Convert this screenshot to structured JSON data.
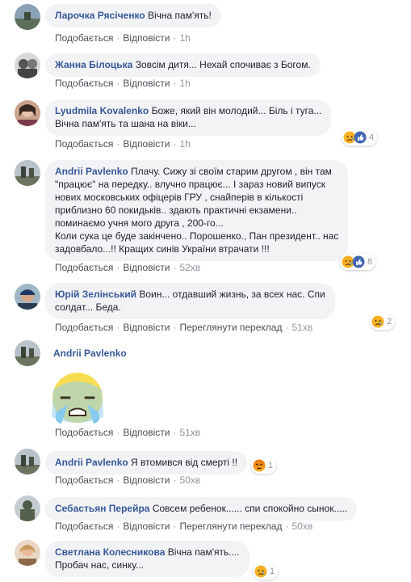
{
  "actions": {
    "like": "Подобається",
    "reply": "Відповісти",
    "translate": "Переглянути переклад"
  },
  "comments": [
    {
      "name": "Ларочка Рясіченко",
      "text": "Вічна пам'ять!",
      "time": "1h"
    },
    {
      "name": "Жанна Білоцька",
      "text": "Зовсім дитя... Нехай спочиває з Богом.",
      "time": "1h"
    },
    {
      "name": "Lyudmila Kovalenko",
      "text": "Боже, який він молодий... Біль і туга...\nВічна пам'ять та шана на віки...",
      "time": "1h",
      "reaction_count": "4"
    },
    {
      "name": "Andrii Pavlenko",
      "text": "Плачу. Сижу зі своїм старим другом , він там\n\"працює\" на передку.. влучно працює... І зараз новий випуск\nнових московських офіцерів ГРУ , снайперів в кількості\nприблизно 60 покидьків.. здають практичні екзамени..\nпоминаємо учня мого друга , 200-го...\nКоли сука це буде закінчено.. Порошенко., Пан президент.. нас\nзадовбало...!! Кращих синів України втрачати !!!",
      "time": "52хв",
      "reaction_count": "8"
    },
    {
      "name": "Юрій Зелінський",
      "text": "Воин... отдавший жизнь, за всех нас. Спи\nсолдат... Беда.",
      "time": "51хв",
      "reaction_count": "2"
    },
    {
      "name": "Andrii Pavlenko",
      "text": "",
      "time": "51хв"
    },
    {
      "name": "Andrii Pavlenko",
      "text": "Я втомився від смерті !!",
      "time": "50хв",
      "reaction_count": "1"
    },
    {
      "name": "Себастьян Перейра",
      "text": "Совсем ребенок...... спи спокойно сынок.....",
      "time": "50хв"
    },
    {
      "name": "Светлана Колесникова",
      "text": "Вічна пам'ять....\nПробач нас, синку...",
      "reaction_count": "1"
    }
  ],
  "colors": {
    "link": "#385898",
    "bubble": "#f2f3f5",
    "meta": "#90949c",
    "like_blue": "#4267b2",
    "sad_yellow": "#f7b125",
    "angry_red": "#e9710f"
  }
}
